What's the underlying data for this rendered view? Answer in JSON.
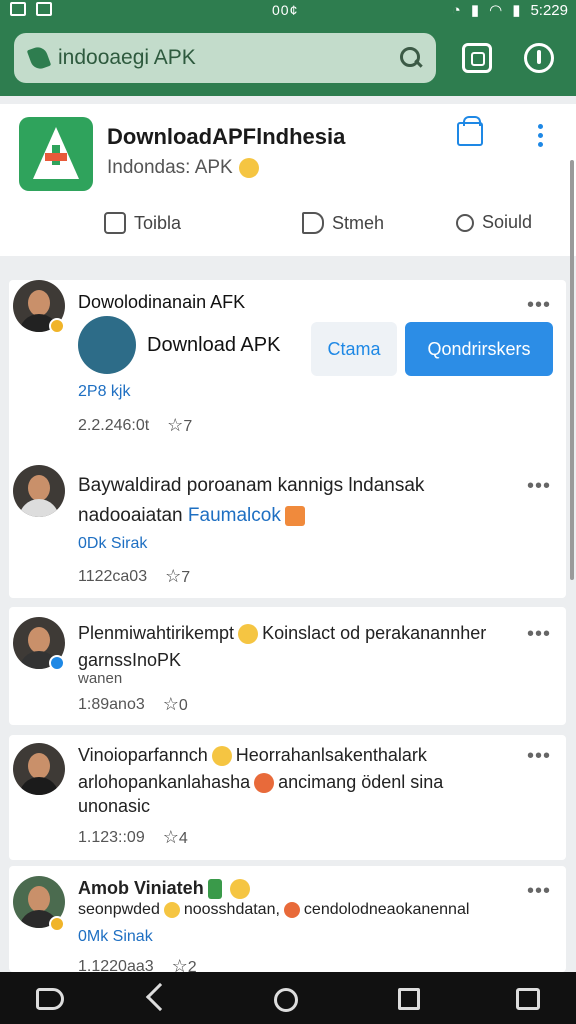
{
  "status": {
    "center": "00¢",
    "time": "5:229"
  },
  "search": {
    "text": "indooaegi APK"
  },
  "header": {
    "title": "DownloadAPFlndhesia",
    "subtitle": "Indondas: APK",
    "actions": [
      {
        "label": "Toibla",
        "icon": "like-icon"
      },
      {
        "label": "Stmeh",
        "icon": "share-icon"
      },
      {
        "label": "Soiuld",
        "icon": "search-icon"
      }
    ]
  },
  "posts": [
    {
      "name": "Dowolodinanain AFK",
      "inner_name": "Download APK",
      "btn_secondary": "Ctama",
      "btn_primary": "Qondrirskers",
      "link": "2P8 kjk",
      "time": "2.2.246:0t",
      "reactions": "7"
    },
    {
      "line1": "Baywaldirad poroanam kannigs lndansak",
      "line2": "nadooaiatan",
      "line2_link": "Faumalcok",
      "link": "0Dk Sirak",
      "time": "1122ca03",
      "reactions": "7"
    },
    {
      "line1a": "Plenmiwahtirikempt",
      "line1b": "Koinslact od perakanannher",
      "line2": "garnssInoPK",
      "line3": "wanen",
      "time": "1:89ano3",
      "reactions": "0"
    },
    {
      "line1a": "Vinoioparfannch",
      "line1b": "Heorrahanlsakenthalark",
      "line2a": "arlohopankanlahasha",
      "line2b": "ancimang ödenl sina",
      "line3": "unonasic",
      "time": "1.123::09",
      "reactions": "4"
    },
    {
      "line1": "Amob Viniateh",
      "line2a": "seonpwded",
      "line2b": "noosshdatan,",
      "line2c": "cendolodneaokanennal",
      "link": "0Mk Sinak",
      "time": "1.1220aa3",
      "reactions": "2"
    }
  ],
  "colors": {
    "brand": "#2e7d4f",
    "accent": "#2c8de6"
  }
}
